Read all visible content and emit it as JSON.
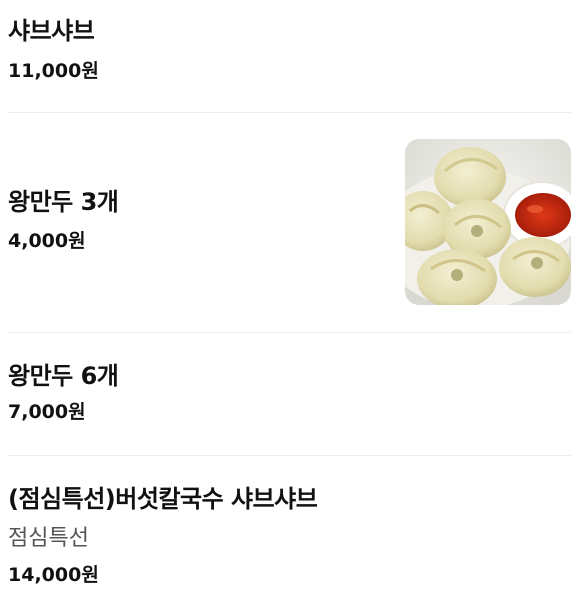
{
  "menu": {
    "items": [
      {
        "name": "샤브샤브",
        "price": "11,000원"
      },
      {
        "name": "왕만두 3개",
        "price": "4,000원",
        "image_icon": "dumplings-photo"
      },
      {
        "name": "왕만두 6개",
        "price": "7,000원"
      },
      {
        "name": "(점심특선)버섯칼국수 샤브샤브",
        "description": "점심특선",
        "price": "14,000원"
      }
    ]
  }
}
